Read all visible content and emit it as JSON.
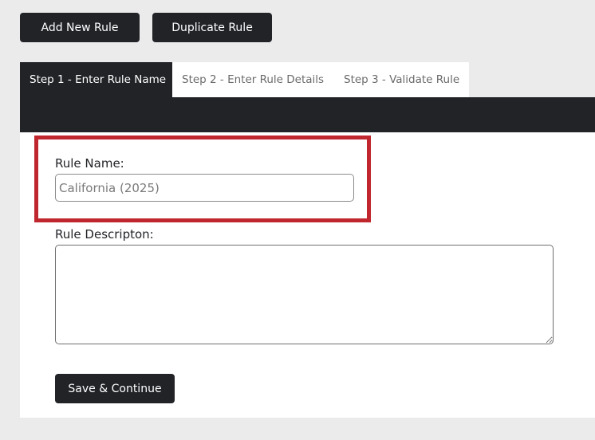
{
  "toolbar": {
    "add_label": "Add New Rule",
    "duplicate_label": "Duplicate Rule"
  },
  "tabs": [
    {
      "label": "Step 1 - Enter Rule Name",
      "active": true
    },
    {
      "label": "Step 2 - Enter Rule Details",
      "active": false
    },
    {
      "label": "Step 3 - Validate Rule",
      "active": false
    }
  ],
  "form": {
    "name_label": "Rule Name:",
    "name_placeholder": "California (2025)",
    "name_value": "",
    "description_label": "Rule Descripton:",
    "description_value": "",
    "save_label": "Save & Continue"
  },
  "colors": {
    "dark": "#212327",
    "highlight": "#c0262d",
    "background": "#ebebeb"
  }
}
